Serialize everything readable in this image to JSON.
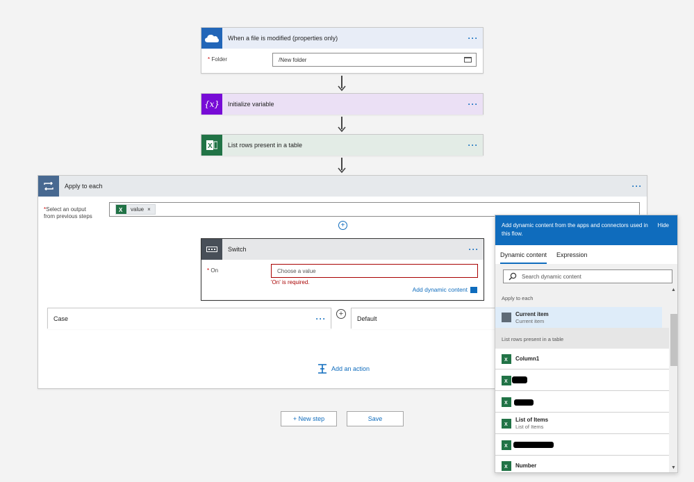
{
  "trigger": {
    "title": "When a file is modified (properties only)",
    "folder_label": "Folder",
    "folder_value": "/New folder",
    "required_mark": "*"
  },
  "init_variable": {
    "title": "Initialize variable",
    "icon_text": "{x}"
  },
  "list_rows": {
    "title": "List rows present in a table"
  },
  "apply_each": {
    "title": "Apply to each",
    "select_label_line1": "Select an output",
    "select_label_line2": "from previous steps",
    "token_text": "value",
    "token_remove": "×",
    "required_mark": "*"
  },
  "switch": {
    "title": "Switch",
    "on_label": "On",
    "on_placeholder": "Choose a value",
    "error_text": "'On' is required.",
    "add_dynamic": "Add dynamic content",
    "required_mark": "*"
  },
  "case": {
    "title": "Case"
  },
  "default": {
    "title": "Default"
  },
  "add_action": "Add an action",
  "buttons": {
    "new_step": "+ New step",
    "save": "Save"
  },
  "dynamic_panel": {
    "header_text": "Add dynamic content from the apps and connectors used in this flow.",
    "hide": "Hide",
    "tabs": [
      "Dynamic content",
      "Expression"
    ],
    "search_placeholder": "Search dynamic content",
    "group_apply": "Apply to each",
    "current_item_title": "Current item",
    "current_item_sub": "Current item",
    "group_list": "List rows present in a table",
    "items": [
      {
        "title": "Column1",
        "sub": ""
      },
      {
        "title": "List of Items",
        "sub": "List of Items"
      },
      {
        "title": "Number",
        "sub": ""
      }
    ]
  },
  "colors": {
    "onedrive": "#2266b8",
    "variable": "#770bd6",
    "excel": "#217346",
    "loop": "#486991",
    "switch": "#484f58",
    "accent": "#0f6cbd",
    "error": "#a80000"
  }
}
